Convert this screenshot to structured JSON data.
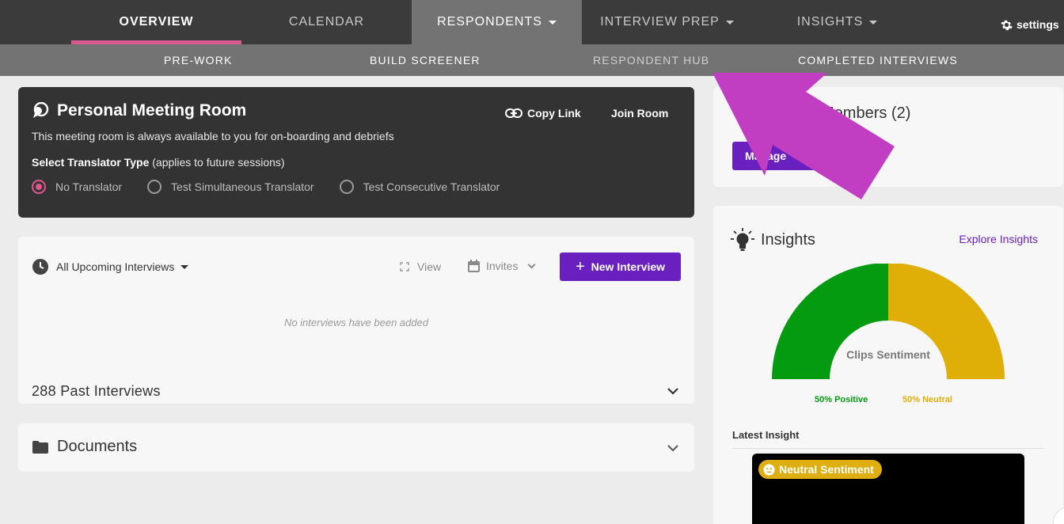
{
  "nav": {
    "tabs": [
      {
        "label": "OVERVIEW"
      },
      {
        "label": "CALENDAR"
      },
      {
        "label": "RESPONDENTS"
      },
      {
        "label": "INTERVIEW PREP"
      },
      {
        "label": "INSIGHTS"
      }
    ],
    "settings_label": "settings"
  },
  "subnav": {
    "items": [
      {
        "label": "PRE-WORK"
      },
      {
        "label": "BUILD SCREENER"
      },
      {
        "label": "RESPONDENT HUB"
      },
      {
        "label": "COMPLETED INTERVIEWS"
      }
    ]
  },
  "meeting_room": {
    "title": "Personal Meeting Room",
    "description": "This meeting room is always available to you for on-boarding and debriefs",
    "translator_label": "Select Translator Type",
    "translator_note": " (applies to future sessions)",
    "options": [
      {
        "label": "No Translator",
        "selected": true
      },
      {
        "label": "Test Simultaneous Translator",
        "selected": false
      },
      {
        "label": "Test Consecutive Translator",
        "selected": false
      }
    ],
    "copy_link": "Copy Link",
    "join_room": "Join Room"
  },
  "interviews": {
    "filter": "All Upcoming Interviews",
    "view_label": "View",
    "invites_label": "Invites",
    "new_button": "New Interview",
    "empty_text": "No interviews have been added",
    "past_label": "288 Past Interviews"
  },
  "documents": {
    "title": "Documents"
  },
  "members": {
    "title": "Members (2)",
    "button": "Manage"
  },
  "insights": {
    "title": "Insights",
    "explore": "Explore Insights",
    "gauge_label": "Clips Sentiment",
    "positive": {
      "label": "50% Positive",
      "value": 50,
      "color": "#049b10"
    },
    "neutral": {
      "label": "50% Neutral",
      "value": 50,
      "color": "#dfae07"
    },
    "latest_label": "Latest Insight",
    "badge": "Neutral Sentiment"
  },
  "colors": {
    "accent": "#6a1fbf",
    "active_tab_underline": "#d85a8f",
    "annotation_arrow": "#c13dc2"
  }
}
